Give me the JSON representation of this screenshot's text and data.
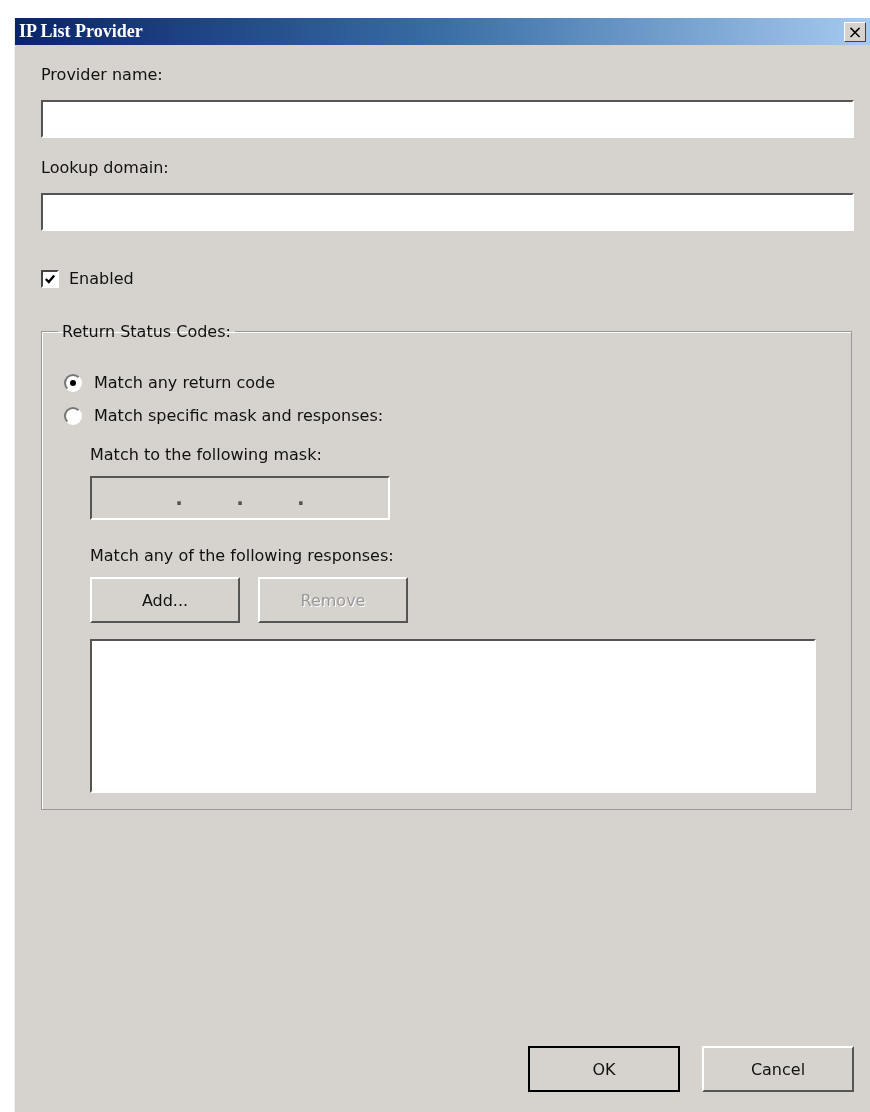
{
  "window": {
    "title": "IP List Provider",
    "close": "×"
  },
  "fields": [
    {
      "label": "Provider name:"
    },
    {
      "label": "Lookup domain:"
    }
  ],
  "enabled": {
    "label": "Enabled",
    "checked": true
  },
  "group": {
    "title": "Return Status Codes:",
    "options": [
      {
        "label": "Match any return code",
        "selected": true
      },
      {
        "label": "Match specific mask and responses:",
        "selected": false
      }
    ],
    "mask": {
      "label": "Match to the following mask:",
      "separators": [
        ".",
        ".",
        "."
      ],
      "disabled": true
    },
    "responses": {
      "label": "Match any of the following responses:",
      "buttons": [
        {
          "label": "Add...",
          "disabled": false
        },
        {
          "label": "Remove",
          "disabled": true
        }
      ]
    }
  },
  "buttons": [
    {
      "label": "OK",
      "default": true
    },
    {
      "label": "Cancel",
      "default": false
    }
  ]
}
